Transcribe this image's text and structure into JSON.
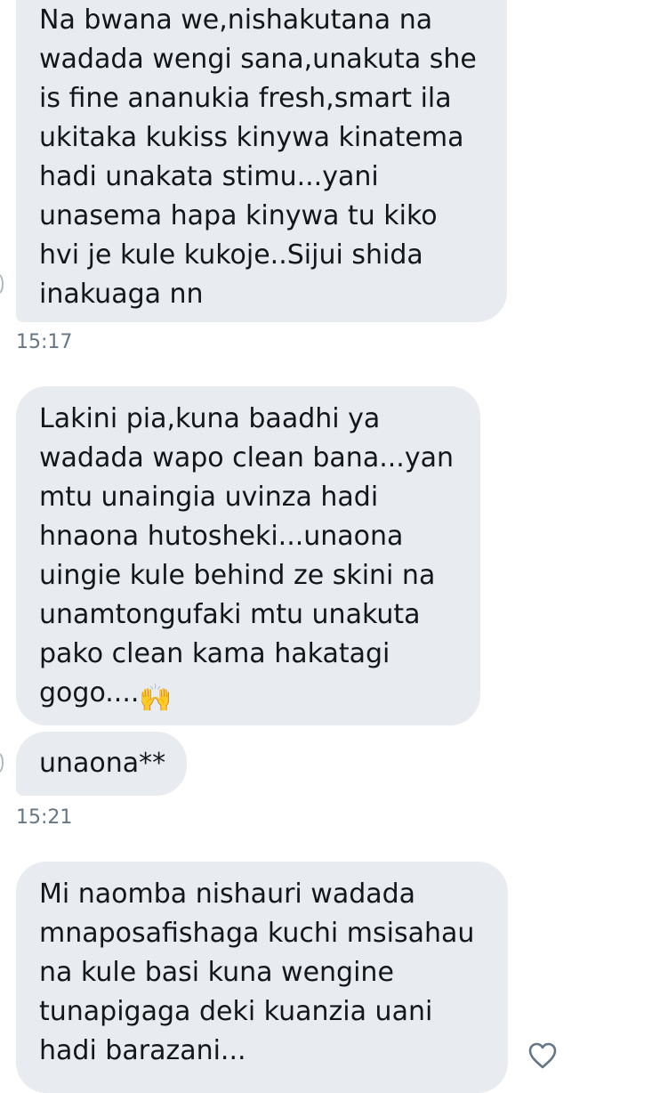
{
  "conversation": {
    "messages": [
      {
        "text": "Na bwana we,nishakutana na\nwadada wengi sana,unakuta she\nis fine ananukia fresh,smart ila\nukitaka kukiss kinywa kinatema\nhadi unakata stimu...yani\nunasema hapa kinywa tu kiko\nhvi je kule kukoje..Sijui shida\ninakuaga nn"
      },
      {
        "text": "Lakini pia,kuna baadhi ya\nwadada wapo clean bana...yan\nmtu unaingia uvinza hadi\nhnaona hutosheki...unaona\nuingie kule behind ze skini na\nunamtongufaki mtu unakuta\npako clean kama hakatagi\ngogo....",
        "emoji": "🙌"
      },
      {
        "text": "unaona**"
      },
      {
        "text": "Mi naomba nishauri wadada\nmnaposafishaga kuchi msisahau\nna kule basi kuna wengine\ntunapigaga deki kuanzia uani\nhadi barazani..."
      }
    ],
    "timestamps": [
      "15:17",
      "15:21"
    ]
  },
  "icons": {
    "like": "heart-outline-icon",
    "reaction": "raising-hands-emoji"
  },
  "colors": {
    "bubble_background": "#e8ecf0",
    "text": "#14171a",
    "timestamp": "#657786",
    "icon_stroke": "#aab8c2"
  }
}
